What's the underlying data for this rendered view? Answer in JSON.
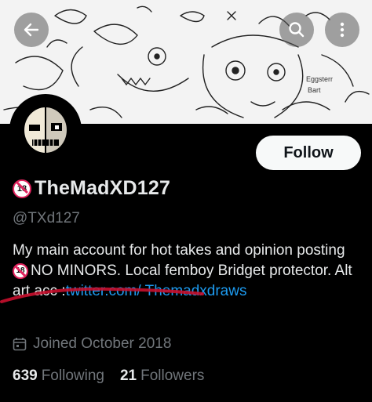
{
  "header": {
    "back_icon": "arrow-left-icon",
    "search_icon": "search-icon",
    "more_icon": "more-vertical-icon"
  },
  "banner": {
    "doodle_text_1": "Eggsterr",
    "doodle_text_2": "Bart"
  },
  "profile": {
    "name": "TheMadXD127",
    "handle": "@TXd127",
    "follow_label": "Follow",
    "bio_part1": "My main account for hot takes and opinion posting ",
    "bio_part2": "NO MINORS. Local femboy Bridget protector. Alt art acc :",
    "bio_link": "twitter.com/ Themadxdraws",
    "joined": "Joined October 2018",
    "following_count": "639",
    "following_label": "Following",
    "followers_count": "21",
    "followers_label": "Followers"
  },
  "colors": {
    "background": "#000000",
    "link": "#1d9bf0",
    "secondary_text": "#71767b",
    "underline_red": "#c8102e"
  }
}
